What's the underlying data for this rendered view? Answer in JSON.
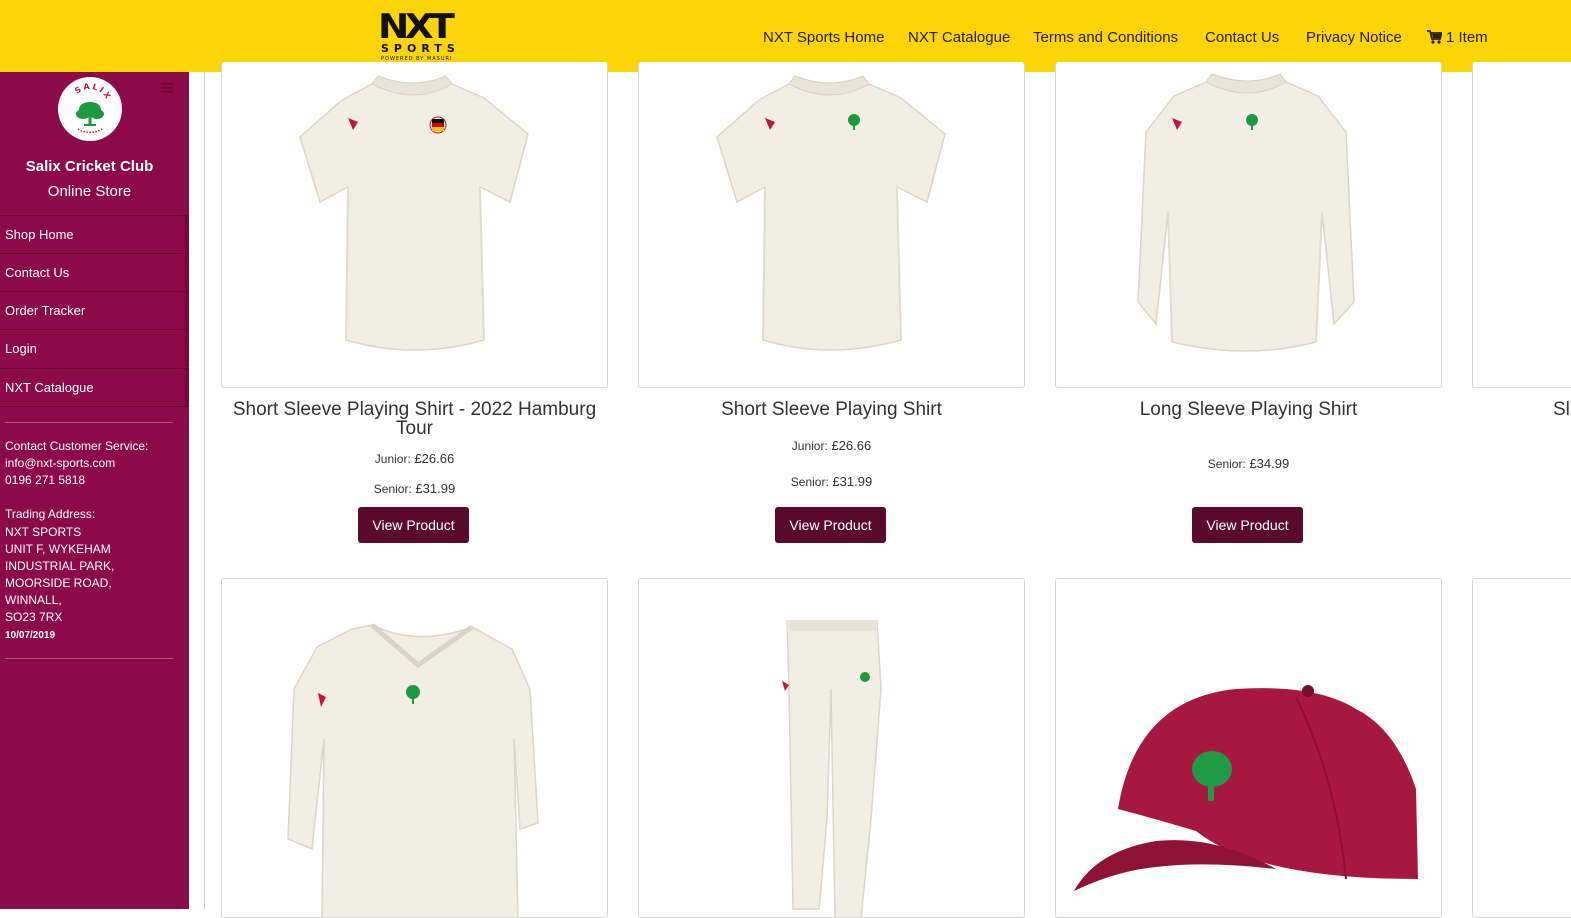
{
  "brand": {
    "logo_main": "NXT",
    "logo_sub": "SPORTS",
    "logo_tagline": "POWERED BY MASURI",
    "color_yellow": "#fdd406",
    "color_maroon": "#8b0a47",
    "color_button": "#5c0a2c"
  },
  "nav": [
    {
      "label": "NXT Sports Home"
    },
    {
      "label": "NXT Catalogue"
    },
    {
      "label": "Terms and Conditions"
    },
    {
      "label": "Contact Us"
    },
    {
      "label": "Privacy Notice"
    }
  ],
  "cart": {
    "label": "1 Item",
    "icon": "cart-icon"
  },
  "sidebar": {
    "badge_text": "SALIX",
    "club_name": "Salix Cricket Club",
    "subtitle": "Online Store",
    "menu": [
      {
        "label": "Shop Home"
      },
      {
        "label": "Contact Us"
      },
      {
        "label": "Order Tracker"
      },
      {
        "label": "Login"
      },
      {
        "label": "NXT Catalogue"
      }
    ],
    "contact_heading": "Contact Customer Service:",
    "contact_email": "info@nxt-sports.com",
    "contact_phone": "0196 271 5818",
    "address_heading": "Trading Address:",
    "address_lines": [
      "NXT SPORTS",
      "UNIT F, WYKEHAM",
      "INDUSTRIAL PARK,",
      "MOORSIDE ROAD,",
      "WINNALL,",
      "SO23 7RX"
    ],
    "date": "10/07/2019"
  },
  "products": [
    {
      "name": "Short Sleeve Playing Shirt - 2022 Hamburg Tour",
      "junior_label": "Junior:",
      "junior_price": "£26.66",
      "senior_label": "Senior:",
      "senior_price": "£31.99",
      "button": "View Product"
    },
    {
      "name": "Short Sleeve Playing Shirt",
      "junior_label": "Junior:",
      "junior_price": "£26.66",
      "senior_label": "Senior:",
      "senior_price": "£31.99",
      "button": "View Product"
    },
    {
      "name": "Long Sleeve Playing Shirt",
      "senior_label": "Senior:",
      "senior_price": "£34.99",
      "button": "View Product"
    },
    {
      "name": "Sl"
    }
  ]
}
